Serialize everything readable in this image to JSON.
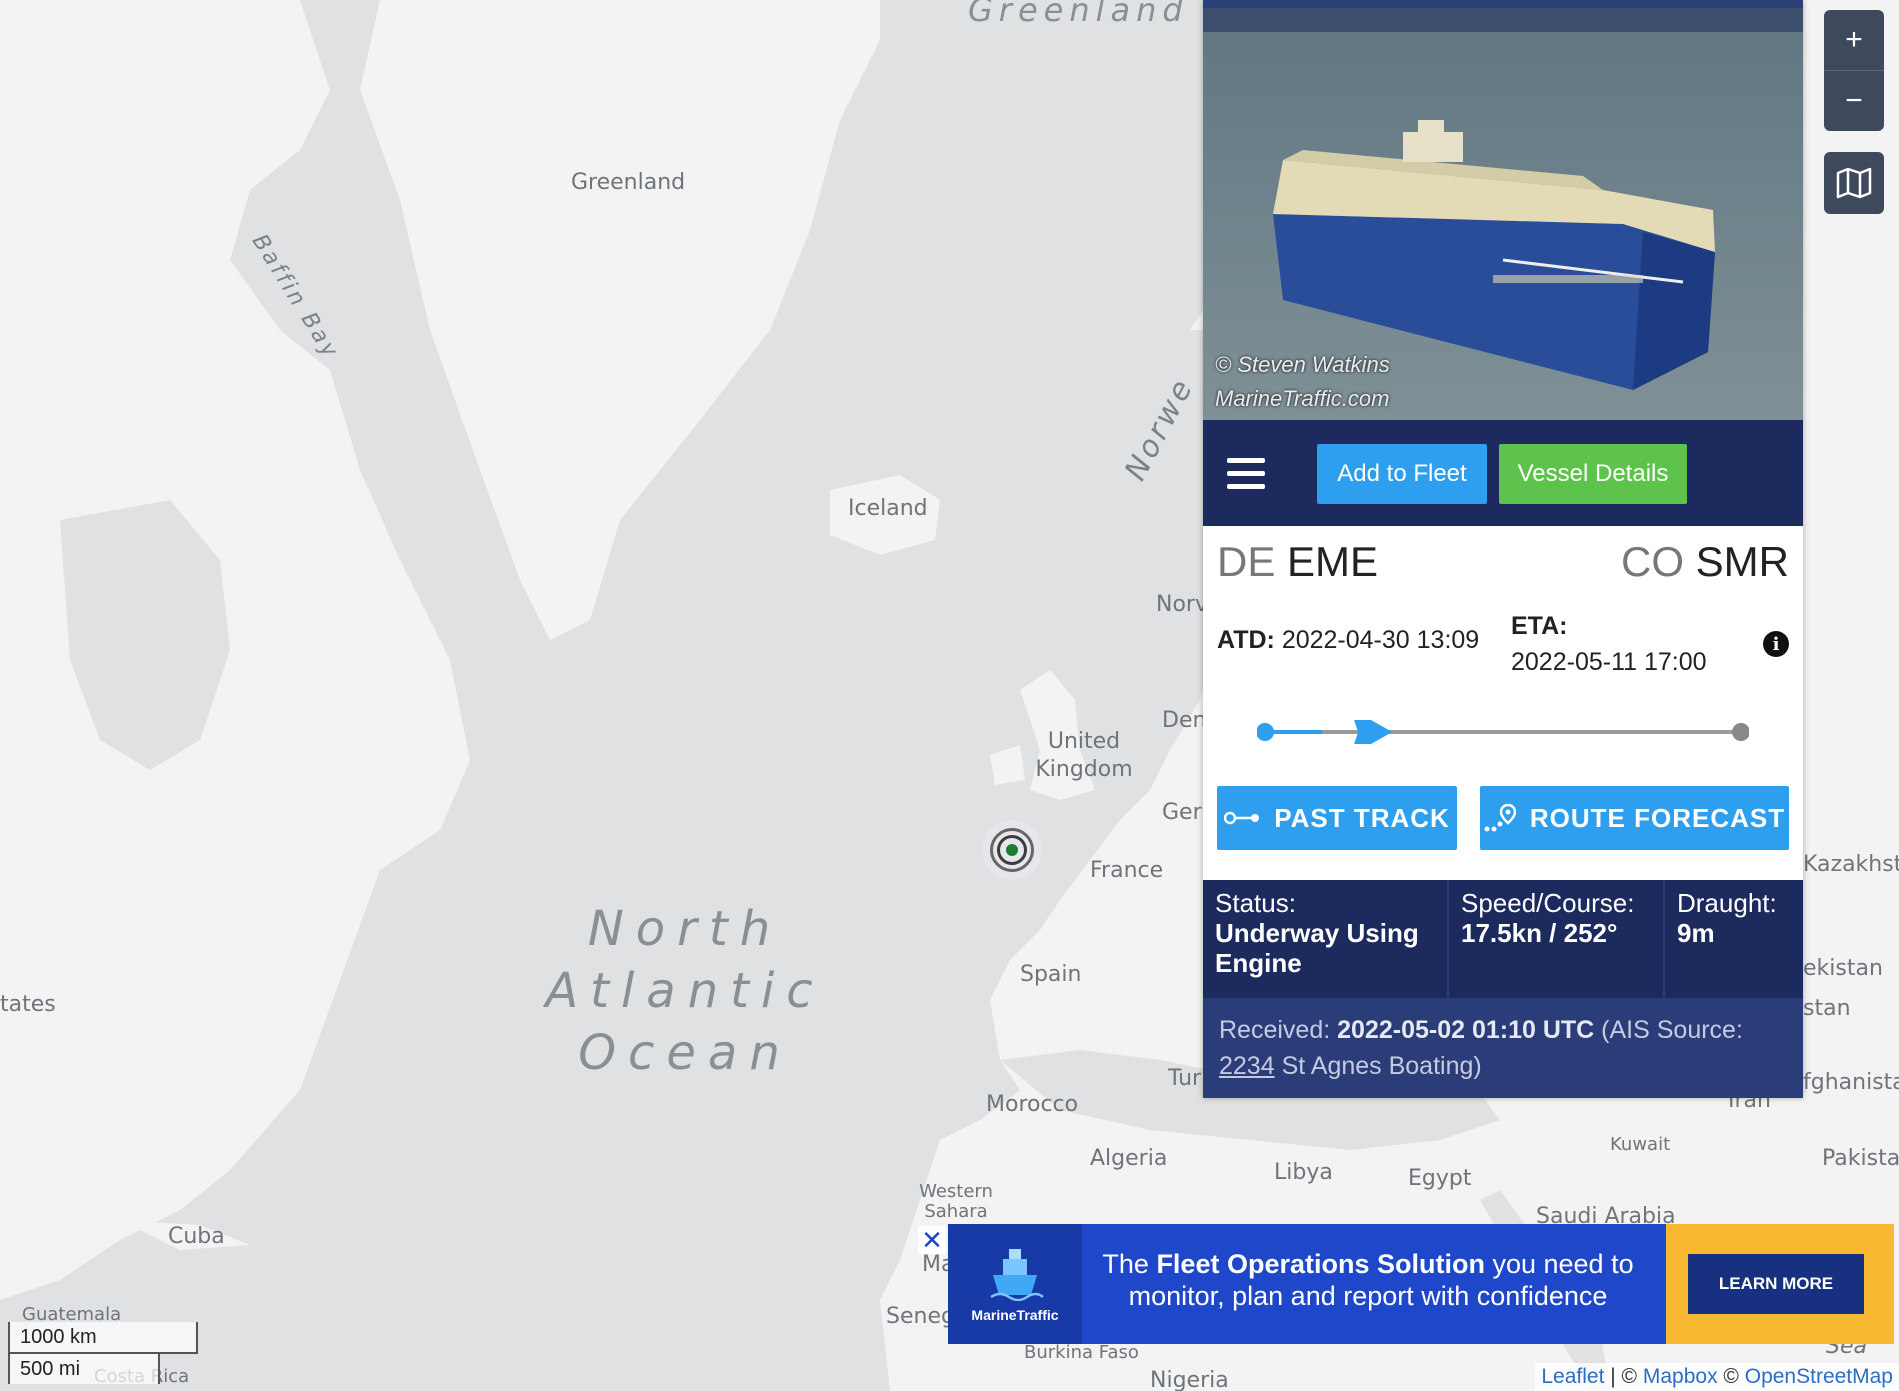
{
  "map": {
    "labels": {
      "greenland_sea": "Greenland Sea",
      "greenland": "Greenland",
      "baffin_bay": "Baffin Bay",
      "iceland": "Iceland",
      "norwegian": "Norwe",
      "norway": "Norv",
      "denmark": "Den",
      "united_kingdom": "United Kingdom",
      "germany": "Ger",
      "france": "France",
      "spain": "Spain",
      "ocean": "North Atlantic Ocean",
      "states": "tates",
      "cuba": "Cuba",
      "guatemala": "Guatemala",
      "costa_rica": "Costa Rica",
      "morocco": "Morocco",
      "algeria": "Algeria",
      "libya": "Libya",
      "egypt": "Egypt",
      "tunisia": "Tur",
      "western_sahara": "Western Sahara",
      "mauritania": "Ma",
      "senegal": "Seneg",
      "burkina_faso": "Burkina Faso",
      "nigeria": "Nigeria",
      "saudi_arabia": "Saudi Arabia",
      "kuwait": "Kuwait",
      "iran": "Iran",
      "kazakhstan": "Kazakhst",
      "pakistan_east": "Pakista",
      "afghanistan": "fghanista",
      "stan": "stan",
      "ekistan": "ekistan",
      "red_sea": "Sea"
    },
    "controls": {
      "zoom_in": "+",
      "zoom_out": "−",
      "layers_icon": "map-icon"
    },
    "scale": {
      "km": "1000 km",
      "mi": "500 mi"
    },
    "attribution": {
      "leaflet": "Leaflet",
      "sep1": " | © ",
      "mapbox": "Mapbox",
      "sep2": " © ",
      "osm": "OpenStreetMap"
    }
  },
  "vessel": {
    "photo_credit_line1": "© Steven Watkins",
    "photo_credit_line2": "MarineTraffic.com",
    "toolbar": {
      "menu_icon": "hamburger-icon",
      "add_to_fleet": "Add to Fleet",
      "vessel_details": "Vessel Details"
    },
    "departure": {
      "country": "DE",
      "port": "EME"
    },
    "arrival": {
      "country": "CO",
      "port": "SMR"
    },
    "atd_label": "ATD:",
    "atd_value": "2022-04-30 13:09",
    "eta_label": "ETA:",
    "eta_value": "2022-05-11 17:00",
    "progress_fraction": 0.12,
    "past_track": "PAST TRACK",
    "route_forecast": "ROUTE FORECAST",
    "status_label": "Status:",
    "status_value": "Underway Using Engine",
    "speed_label": "Speed/Course:",
    "speed_value": "17.5kn / 252°",
    "draught_label": "Draught:",
    "draught_value": "9m",
    "received_label": "Received:",
    "received_value": "2022-05-02 01:10 UTC",
    "received_source_prefix": "(AIS Source:",
    "received_source_id": "2234",
    "received_source_name": "St Agnes Boating)"
  },
  "ad": {
    "logo_name": "MarineTraffic",
    "text_pre": "The ",
    "text_bold": "Fleet Operations Solution",
    "text_post": " you need to monitor, plan and report with confidence",
    "cta": "LEARN MORE",
    "close": "✕"
  },
  "colors": {
    "panel_navy": "#1c2a5e",
    "button_blue": "#2e9fef",
    "button_green": "#5dc34c",
    "ad_blue": "#1e47c9",
    "ad_yellow": "#f8b832"
  }
}
